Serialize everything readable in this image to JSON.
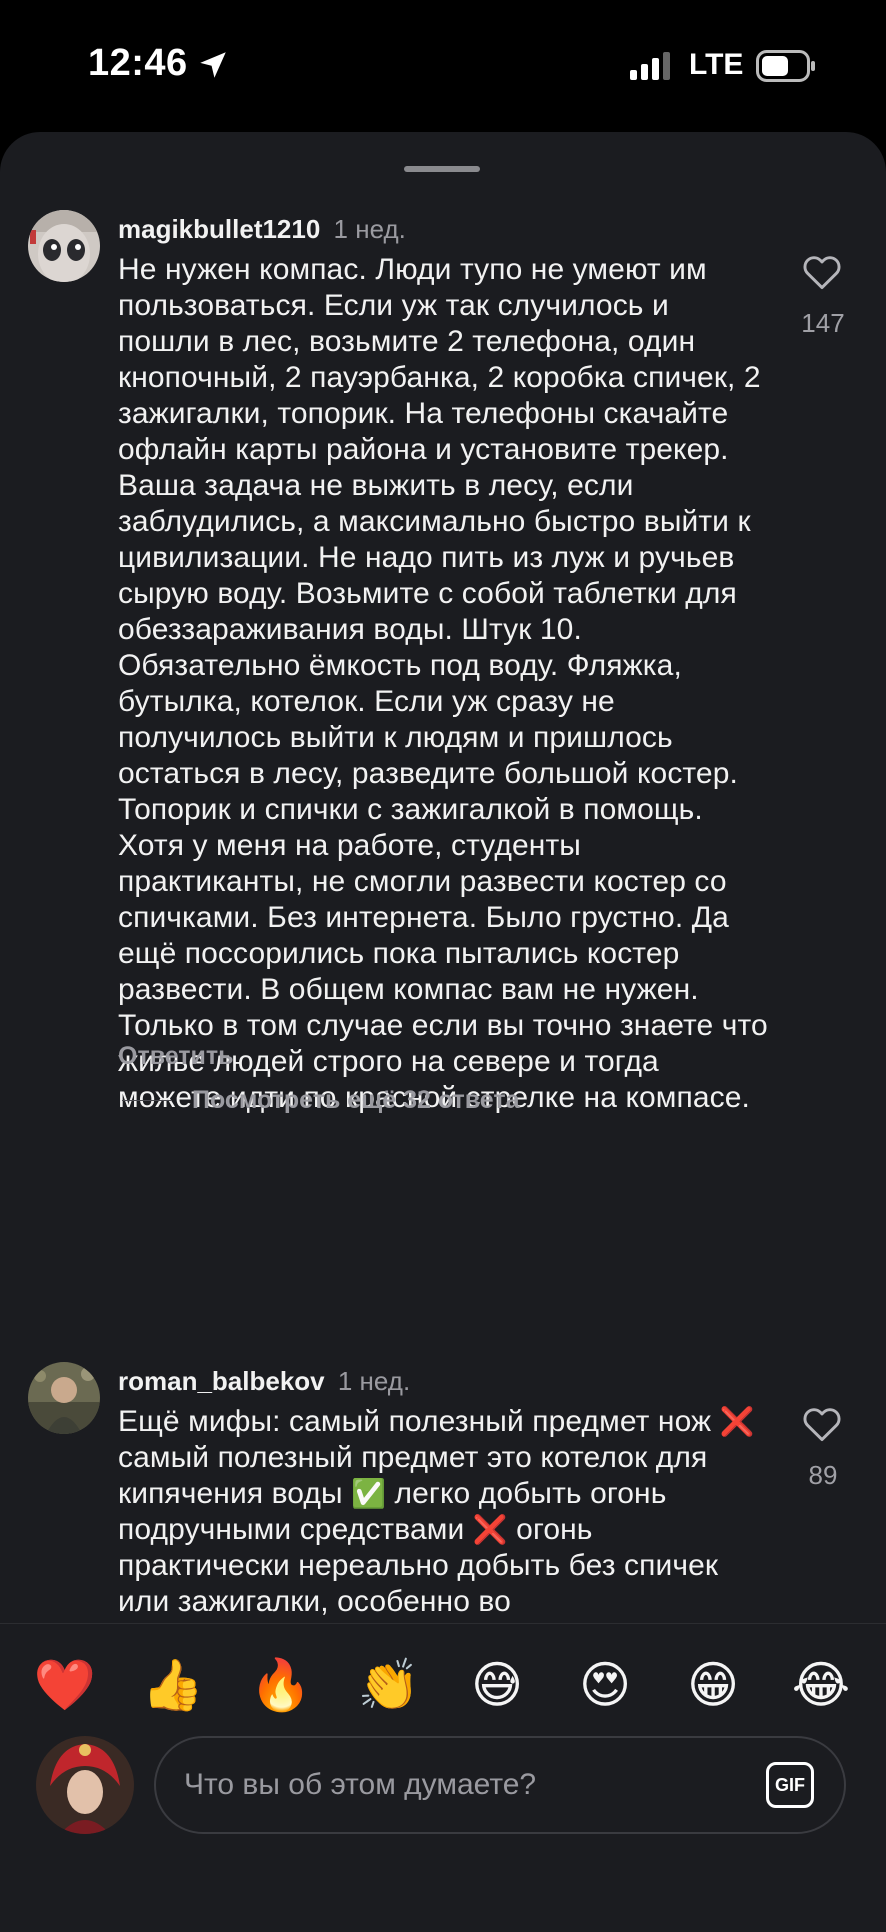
{
  "status_bar": {
    "time": "12:46",
    "network": "LTE",
    "icons": [
      "location-arrow-icon",
      "signal-bars-icon",
      "battery-icon"
    ]
  },
  "comments": [
    {
      "author": "magikbullet1210",
      "age": "1 нед.",
      "text": "Не нужен компас. Люди тупо не умеют им пользоваться. Если уж так случилось и пошли в лес, возьмите 2 телефона, один кнопочный, 2 пауэрбанка, 2 коробка спичек, 2 зажигалки, топорик. На телефоны скачайте офлайн карты района и установите трекер. Ваша задача не выжить в лесу, если заблудились, а максимально быстро выйти к цивилизации. Не надо пить из луж и ручьев сырую воду. Возьмите с собой таблетки для обеззараживания воды. Штук 10. Обязательно ёмкость под воду. Фляжка, бутылка, котелок. Если уж сразу не получилось выйти к людям и пришлось остаться в лесу, разведите большой костер. Топорик и спички с зажигалкой в помощь. Хотя у меня на работе, студенты практиканты, не смогли развести костер со спичками. Без интернета. Было грустно. Да ещё поссорились пока пытались костер развести. В общем компас вам не нужен. Только в том случае если вы точно знаете что жилье людей строго на севере и тогда можете идти по красной стрелке на компасе.",
      "likes": "147",
      "reply_label": "Ответить",
      "more_replies": "Посмотреть ещё 32 ответа"
    },
    {
      "author": "roman_balbekov",
      "age": "1 нед.",
      "text_parts": [
        "Ещё мифы: самый полезный предмет нож ",
        "❌",
        " самый полезный предмет это котелок для кипячения воды ",
        "✅",
        " легко добыть огонь подручными средствами ",
        "❌",
        " огонь практически нереально добыть без спичек или зажигалки, особенно во"
      ],
      "likes": "89"
    }
  ],
  "reactions": [
    "❤️",
    "👍",
    "🔥",
    "👏",
    "😅",
    "😍",
    "😁",
    "😂"
  ],
  "composer": {
    "placeholder": "Что вы об этом думаете?",
    "gif_label": "GIF"
  },
  "colors": {
    "background": "#1b1c20",
    "text": "#f2f2f2",
    "secondary": "#9a9aa0"
  }
}
